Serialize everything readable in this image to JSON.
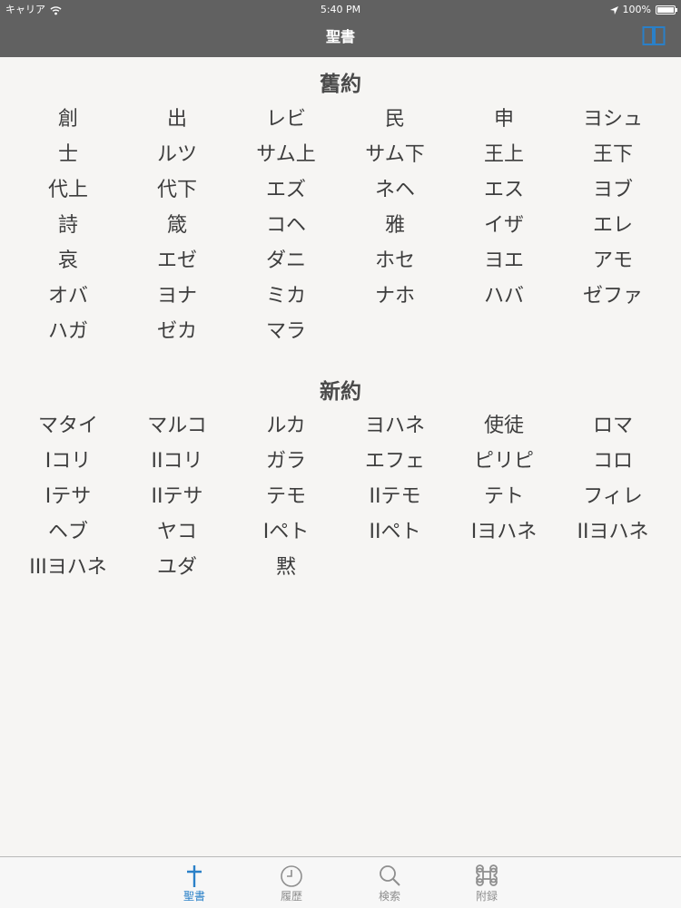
{
  "status": {
    "carrier": "キャリア",
    "time": "5:40 PM",
    "battery": "100%"
  },
  "nav": {
    "title": "聖書"
  },
  "old_testament": {
    "title": "舊約",
    "books": [
      "創",
      "出",
      "レビ",
      "民",
      "申",
      "ヨシュ",
      "士",
      "ルツ",
      "サム上",
      "サム下",
      "王上",
      "王下",
      "代上",
      "代下",
      "エズ",
      "ネヘ",
      "エス",
      "ヨブ",
      "詩",
      "箴",
      "コヘ",
      "雅",
      "イザ",
      "エレ",
      "哀",
      "エゼ",
      "ダニ",
      "ホセ",
      "ヨエ",
      "アモ",
      "オバ",
      "ヨナ",
      "ミカ",
      "ナホ",
      "ハバ",
      "ゼファ",
      "ハガ",
      "ゼカ",
      "マラ"
    ]
  },
  "new_testament": {
    "title": "新約",
    "books": [
      "マタイ",
      "マルコ",
      "ルカ",
      "ヨハネ",
      "使徒",
      "ロマ",
      "Iコリ",
      "IIコリ",
      "ガラ",
      "エフェ",
      "ピリピ",
      "コロ",
      "Iテサ",
      "IIテサ",
      "テモ",
      "IIテモ",
      "テト",
      "フィレ",
      "ヘブ",
      "ヤコ",
      "Iペト",
      "IIペト",
      "Iヨハネ",
      "IIヨハネ",
      "IIIヨハネ",
      "ユダ",
      "黙"
    ]
  },
  "tabs": [
    {
      "label": "聖書",
      "icon": "cross-icon"
    },
    {
      "label": "履歴",
      "icon": "clock-icon"
    },
    {
      "label": "検索",
      "icon": "magnifier-icon"
    },
    {
      "label": "附録",
      "icon": "command-icon"
    }
  ],
  "colors": {
    "accent": "#2a80c8",
    "navbar": "#616161",
    "background": "#f6f5f3"
  }
}
